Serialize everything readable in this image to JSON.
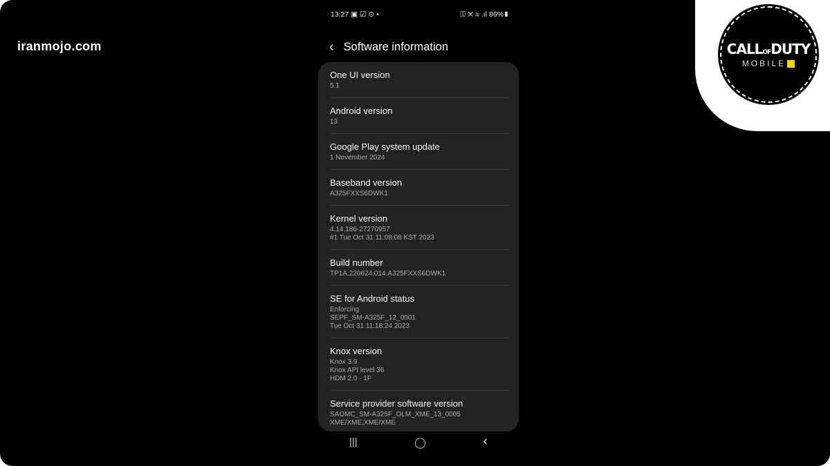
{
  "site": "iranmojo.com",
  "logo": {
    "line1": "CALL OF DUTY",
    "line2": "MOBILE"
  },
  "status": {
    "time": "13:27",
    "left_icons": [
      "image-icon",
      "check-icon",
      "location-icon",
      "dot-icon"
    ],
    "right_icons": [
      "key-icon",
      "mute-icon",
      "wifi-icon",
      "signal-icon"
    ],
    "battery": "86%"
  },
  "header": {
    "title": "Software information"
  },
  "items": [
    {
      "title": "One UI version",
      "lines": [
        "5.1"
      ]
    },
    {
      "title": "Android version",
      "lines": [
        "13"
      ]
    },
    {
      "title": "Google Play system update",
      "lines": [
        "1 November 2024"
      ]
    },
    {
      "title": "Baseband version",
      "lines": [
        "A325FXXS6DWK1"
      ]
    },
    {
      "title": "Kernel version",
      "lines": [
        "4.14.186-27270957",
        "#1 Tue Oct 31 11:08:08 KST 2023"
      ]
    },
    {
      "title": "Build number",
      "lines": [
        "TP1A.220624.014.A325FXXS6DWK1"
      ]
    },
    {
      "title": "SE for Android status",
      "lines": [
        "Enforcing",
        "SEPF_SM-A325F_12_0001",
        "Tue Oct 31 11:18:24 2023"
      ]
    },
    {
      "title": "Knox version",
      "lines": [
        "Knox 3.9",
        "Knox API level 36",
        "HDM 2.0 - 1F"
      ]
    },
    {
      "title": "Service provider software version",
      "lines": [
        "SAOMC_SM-A325F_OLM_XME_13_0005",
        "XME/XME,XME/XME"
      ]
    }
  ],
  "nav": {
    "recents": "|||",
    "home": "◯",
    "back": "‹"
  }
}
